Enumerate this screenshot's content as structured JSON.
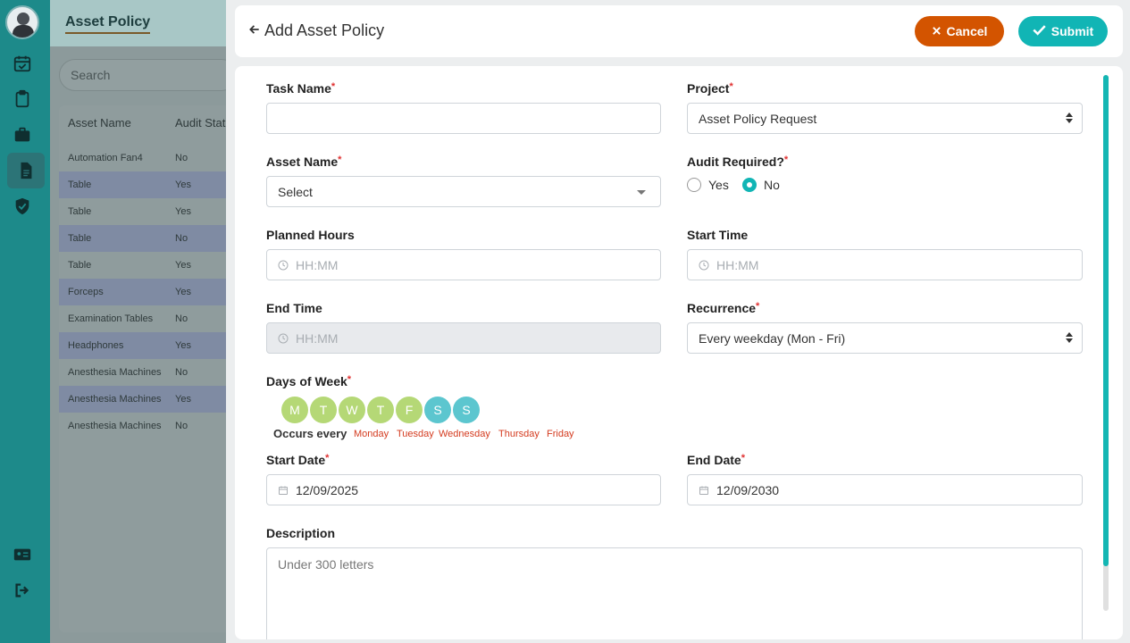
{
  "background": {
    "page_title": "Asset Policy",
    "search_placeholder": "Search",
    "columns": [
      "Asset Name",
      "Audit Stat"
    ],
    "rows": [
      {
        "name": "Automation Fan4",
        "audit": "No"
      },
      {
        "name": "Table",
        "audit": "Yes"
      },
      {
        "name": "Table",
        "audit": "Yes"
      },
      {
        "name": "Table",
        "audit": "No"
      },
      {
        "name": "Table",
        "audit": "Yes"
      },
      {
        "name": "Forceps",
        "audit": "Yes"
      },
      {
        "name": "Examination Tables",
        "audit": "No"
      },
      {
        "name": "Headphones",
        "audit": "Yes"
      },
      {
        "name": "Anesthesia Machines",
        "audit": "No"
      },
      {
        "name": "Anesthesia Machines",
        "audit": "Yes"
      },
      {
        "name": "Anesthesia Machines",
        "audit": "No"
      }
    ]
  },
  "modal": {
    "title": "Add Asset Policy",
    "cancel_label": "Cancel",
    "submit_label": "Submit",
    "required_mark": "*",
    "task_name": {
      "label": "Task Name",
      "value": ""
    },
    "project": {
      "label": "Project",
      "value": "Asset Policy Request"
    },
    "asset_name": {
      "label": "Asset Name",
      "value": "Select"
    },
    "audit_required": {
      "label": "Audit Required?",
      "options": [
        "Yes",
        "No"
      ],
      "selected": "No"
    },
    "planned_hours": {
      "label": "Planned Hours",
      "placeholder": "HH:MM"
    },
    "start_time": {
      "label": "Start Time",
      "placeholder": "HH:MM"
    },
    "end_time": {
      "label": "End Time",
      "placeholder": "HH:MM"
    },
    "recurrence": {
      "label": "Recurrence",
      "value": "Every weekday (Mon - Fri)"
    },
    "days_of_week": {
      "label": "Days of Week",
      "days": [
        {
          "letter": "M",
          "selected": true
        },
        {
          "letter": "T",
          "selected": true
        },
        {
          "letter": "W",
          "selected": true
        },
        {
          "letter": "T",
          "selected": true
        },
        {
          "letter": "F",
          "selected": true
        },
        {
          "letter": "S",
          "selected": false
        },
        {
          "letter": "S",
          "selected": false
        }
      ],
      "occurs_label": "Occurs every",
      "occurs_days": [
        "Monday",
        "Tuesday",
        "Wednesday",
        "Thursday",
        "Friday"
      ]
    },
    "start_date": {
      "label": "Start Date",
      "value": "12/09/2025"
    },
    "end_date": {
      "label": "End Date",
      "value": "12/09/2030"
    },
    "description": {
      "label": "Description",
      "placeholder": "Under 300 letters"
    }
  },
  "colors": {
    "sidebar": "#1d8a8a",
    "cancel": "#d35400",
    "submit": "#11b5b5",
    "day_selected": "#b5d876",
    "day_unselected": "#5cc6cf",
    "required": "#e03131",
    "occurs_days": "#d43b1f"
  },
  "sidebar_icons": [
    "calendar-check-icon",
    "clipboard-icon",
    "briefcase-icon",
    "document-icon",
    "shield-check-icon",
    "id-card-icon",
    "logout-icon"
  ]
}
